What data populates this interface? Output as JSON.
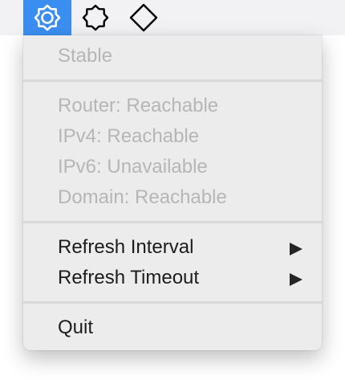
{
  "menubar": {
    "items": [
      {
        "icon": "network-status-icon",
        "active": true
      },
      {
        "icon": "octagon-status-icon",
        "active": false
      },
      {
        "icon": "diamond-status-icon",
        "active": false
      }
    ],
    "accent_color": "#3b8ef1"
  },
  "menu": {
    "status_label": "Stable",
    "details": [
      "Router: Reachable",
      "IPv4: Reachable",
      "IPv6: Unavailable",
      "Domain: Reachable"
    ],
    "actions": [
      {
        "label": "Refresh Interval",
        "submenu_icon": "submenu-arrow-icon"
      },
      {
        "label": "Refresh Timeout",
        "submenu_icon": "submenu-arrow-icon"
      }
    ],
    "quit_label": "Quit"
  }
}
